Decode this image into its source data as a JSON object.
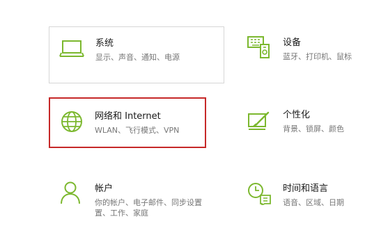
{
  "accent_color": "#7cb82f",
  "selection_border_color": "#c62828",
  "tiles": [
    {
      "id": "system",
      "title": "系统",
      "desc_lines": [
        "显示、声音、通知、电源"
      ],
      "icon": "laptop-icon"
    },
    {
      "id": "devices",
      "title": "设备",
      "desc_lines": [
        "蓝牙、打印机、鼠标"
      ],
      "icon": "devices-icon"
    },
    {
      "id": "network",
      "title": "网络和 Internet",
      "desc_lines": [
        "WLAN、飞行模式、VPN"
      ],
      "icon": "globe-icon"
    },
    {
      "id": "personalization",
      "title": "个性化",
      "desc_lines": [
        "背景、锁屏、颜色"
      ],
      "icon": "paintbrush-icon"
    },
    {
      "id": "accounts",
      "title": "帐户",
      "desc_lines": [
        "你的帐户、电子邮件、同步设置",
        "置、工作、家庭"
      ],
      "icon": "person-icon"
    },
    {
      "id": "time-language",
      "title": "时间和语言",
      "desc_lines": [
        "语音、区域、日期"
      ],
      "icon": "clock-language-icon"
    }
  ]
}
